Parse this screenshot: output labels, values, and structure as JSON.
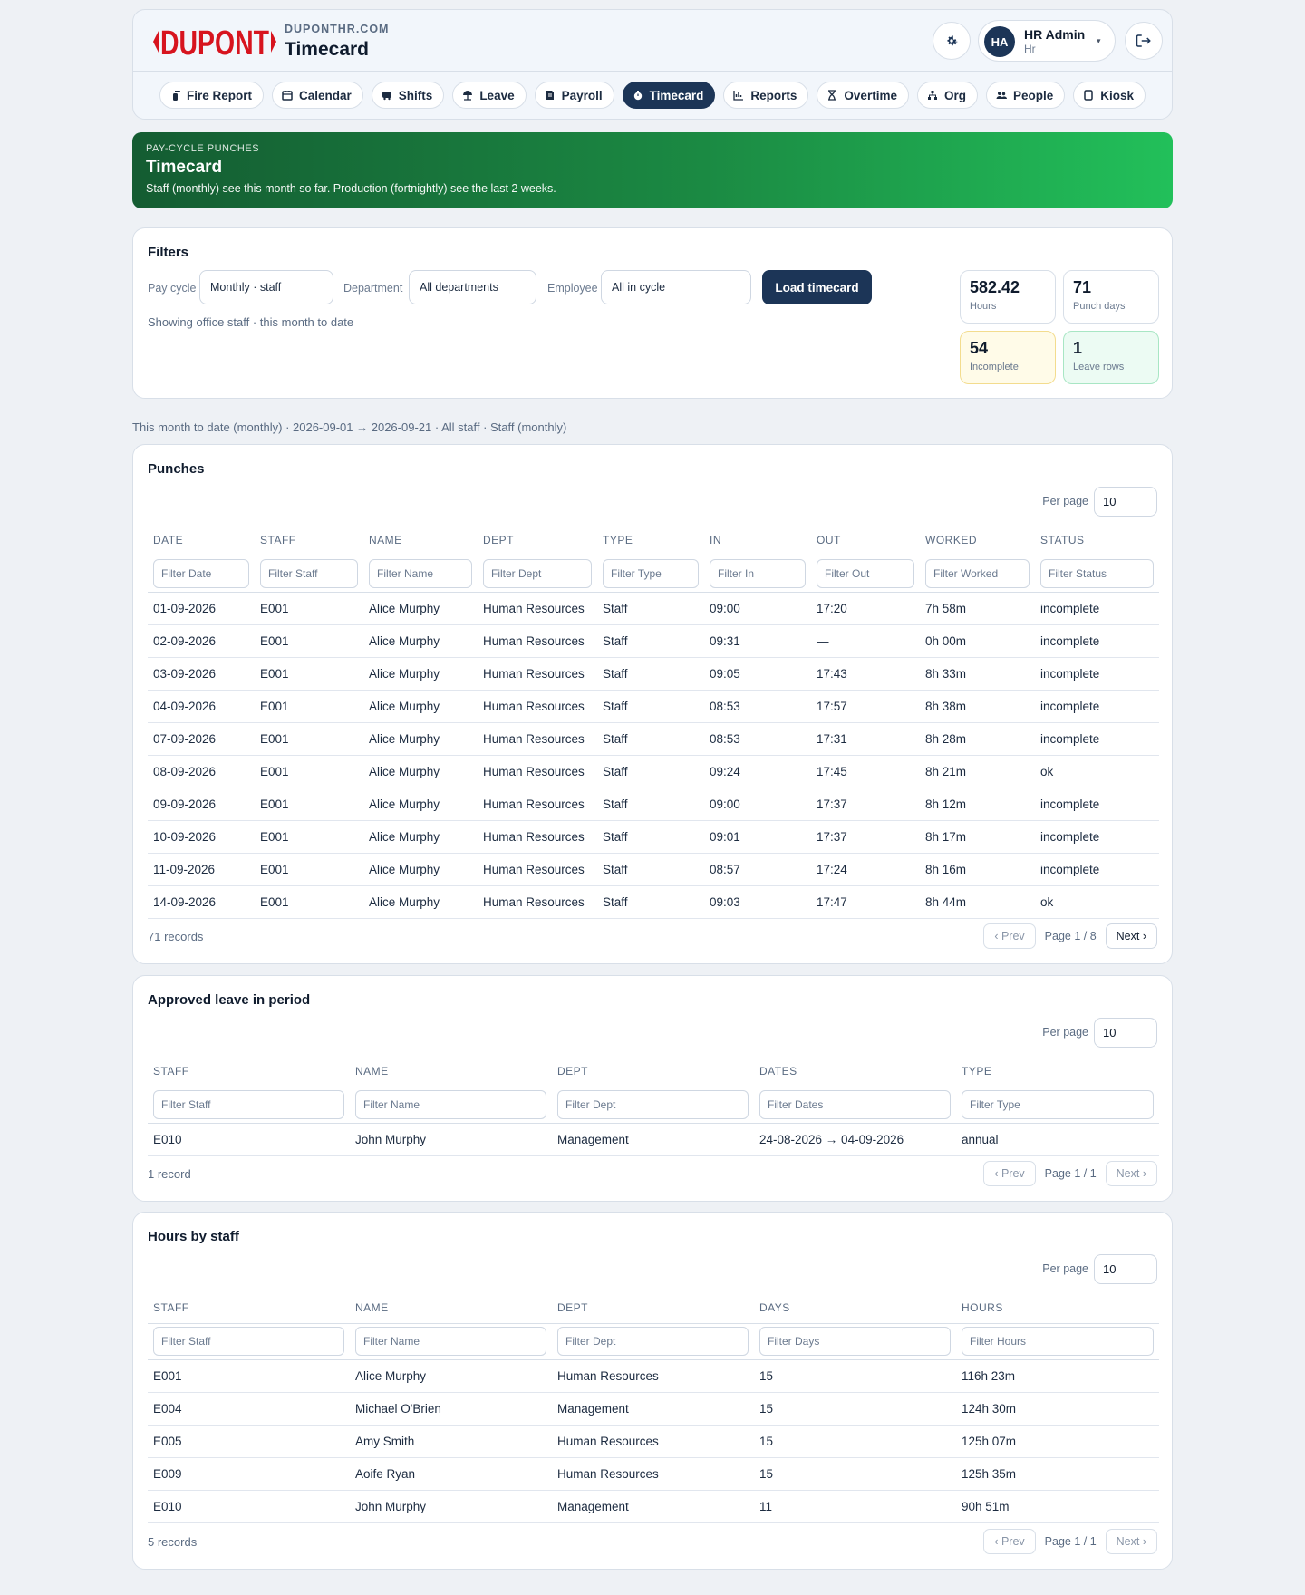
{
  "brand": {
    "logo_text": "DUPONT",
    "site": "DUPONTHR.COM",
    "page_title": "Timecard",
    "accent": "#1c3557",
    "logo_red": "#d7141e"
  },
  "user": {
    "initials": "HA",
    "name": "HR Admin",
    "role": "Hr"
  },
  "nav": [
    {
      "label": "Fire Report",
      "icon": "fire-extinguisher-icon"
    },
    {
      "label": "Calendar",
      "icon": "calendar-icon"
    },
    {
      "label": "Shifts",
      "icon": "bus-icon"
    },
    {
      "label": "Leave",
      "icon": "umbrella-beach-icon"
    },
    {
      "label": "Payroll",
      "icon": "file-invoice-icon"
    },
    {
      "label": "Timecard",
      "icon": "stopwatch-icon",
      "active": true
    },
    {
      "label": "Reports",
      "icon": "chart-bar-icon"
    },
    {
      "label": "Overtime",
      "icon": "hourglass-icon"
    },
    {
      "label": "Org",
      "icon": "sitemap-icon"
    },
    {
      "label": "People",
      "icon": "users-icon"
    },
    {
      "label": "Kiosk",
      "icon": "tablet-icon"
    }
  ],
  "banner": {
    "kicker": "PAY-CYCLE PUNCHES",
    "title": "Timecard",
    "subtitle": "Staff (monthly) see this month so far. Production (fortnightly) see the last 2 weeks."
  },
  "filters": {
    "title": "Filters",
    "pay_cycle_label": "Pay cycle",
    "pay_cycle_value": "Monthly · staff",
    "department_label": "Department",
    "department_value": "All departments",
    "employee_label": "Employee",
    "employee_value": "All in cycle",
    "load_button": "Load timecard",
    "note": "Showing office staff · this month to date"
  },
  "stats": {
    "hours": {
      "value": "582.42",
      "label": "Hours"
    },
    "punch_days": {
      "value": "71",
      "label": "Punch days"
    },
    "incomplete": {
      "value": "54",
      "label": "Incomplete"
    },
    "leave_rows": {
      "value": "1",
      "label": "Leave rows"
    }
  },
  "period_text": "This month to date (monthly) · 2026-09-01 → 2026-09-21 · All staff · Staff (monthly)",
  "punches": {
    "title": "Punches",
    "per_page_label": "Per page",
    "per_page": "10",
    "headers": [
      "DATE",
      "STAFF",
      "NAME",
      "DEPT",
      "TYPE",
      "IN",
      "OUT",
      "WORKED",
      "STATUS"
    ],
    "filters": [
      "Filter Date",
      "Filter Staff",
      "Filter Name",
      "Filter Dept",
      "Filter Type",
      "Filter In",
      "Filter Out",
      "Filter Worked",
      "Filter Status"
    ],
    "rows": [
      [
        "01-09-2026",
        "E001",
        "Alice Murphy",
        "Human Resources",
        "Staff",
        "09:00",
        "17:20",
        "7h 58m",
        "incomplete"
      ],
      [
        "02-09-2026",
        "E001",
        "Alice Murphy",
        "Human Resources",
        "Staff",
        "09:31",
        "—",
        "0h 00m",
        "incomplete"
      ],
      [
        "03-09-2026",
        "E001",
        "Alice Murphy",
        "Human Resources",
        "Staff",
        "09:05",
        "17:43",
        "8h 33m",
        "incomplete"
      ],
      [
        "04-09-2026",
        "E001",
        "Alice Murphy",
        "Human Resources",
        "Staff",
        "08:53",
        "17:57",
        "8h 38m",
        "incomplete"
      ],
      [
        "07-09-2026",
        "E001",
        "Alice Murphy",
        "Human Resources",
        "Staff",
        "08:53",
        "17:31",
        "8h 28m",
        "incomplete"
      ],
      [
        "08-09-2026",
        "E001",
        "Alice Murphy",
        "Human Resources",
        "Staff",
        "09:24",
        "17:45",
        "8h 21m",
        "ok"
      ],
      [
        "09-09-2026",
        "E001",
        "Alice Murphy",
        "Human Resources",
        "Staff",
        "09:00",
        "17:37",
        "8h 12m",
        "incomplete"
      ],
      [
        "10-09-2026",
        "E001",
        "Alice Murphy",
        "Human Resources",
        "Staff",
        "09:01",
        "17:37",
        "8h 17m",
        "incomplete"
      ],
      [
        "11-09-2026",
        "E001",
        "Alice Murphy",
        "Human Resources",
        "Staff",
        "08:57",
        "17:24",
        "8h 16m",
        "incomplete"
      ],
      [
        "14-09-2026",
        "E001",
        "Alice Murphy",
        "Human Resources",
        "Staff",
        "09:03",
        "17:47",
        "8h 44m",
        "ok"
      ]
    ],
    "count": "71 records",
    "prev": "‹ Prev",
    "page": "Page 1 / 8",
    "next": "Next ›"
  },
  "leave": {
    "title": "Approved leave in period",
    "per_page_label": "Per page",
    "per_page": "10",
    "headers": [
      "STAFF",
      "NAME",
      "DEPT",
      "DATES",
      "TYPE"
    ],
    "filters": [
      "Filter Staff",
      "Filter Name",
      "Filter Dept",
      "Filter Dates",
      "Filter Type"
    ],
    "rows": [
      [
        "E010",
        "John Murphy",
        "Management",
        "24-08-2026 → 04-09-2026",
        "annual"
      ]
    ],
    "count": "1 record",
    "prev": "‹ Prev",
    "page": "Page 1 / 1",
    "next": "Next ›"
  },
  "hours_by_staff": {
    "title": "Hours by staff",
    "per_page_label": "Per page",
    "per_page": "10",
    "headers": [
      "STAFF",
      "NAME",
      "DEPT",
      "DAYS",
      "HOURS"
    ],
    "filters": [
      "Filter Staff",
      "Filter Name",
      "Filter Dept",
      "Filter Days",
      "Filter Hours"
    ],
    "rows": [
      [
        "E001",
        "Alice Murphy",
        "Human Resources",
        "15",
        "116h 23m"
      ],
      [
        "E004",
        "Michael O'Brien",
        "Management",
        "15",
        "124h 30m"
      ],
      [
        "E005",
        "Amy Smith",
        "Human Resources",
        "15",
        "125h 07m"
      ],
      [
        "E009",
        "Aoife Ryan",
        "Human Resources",
        "15",
        "125h 35m"
      ],
      [
        "E010",
        "John Murphy",
        "Management",
        "11",
        "90h 51m"
      ]
    ],
    "count": "5 records",
    "prev": "‹ Prev",
    "page": "Page 1 / 1",
    "next": "Next ›"
  }
}
